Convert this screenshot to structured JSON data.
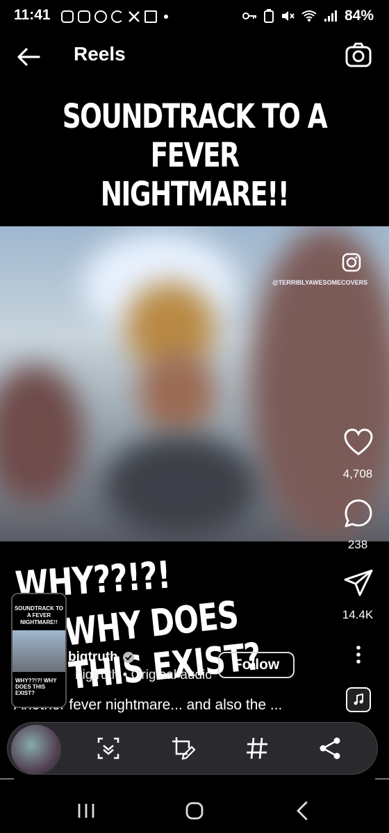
{
  "status_bar": {
    "time": "11:41",
    "battery": "84%",
    "left_icons": [
      "discord-icon",
      "instagram-icon",
      "check-circle-icon",
      "crunchyroll-icon",
      "x-icon",
      "twitch-icon"
    ],
    "right_icons": [
      "key-icon",
      "battery-saver-icon",
      "mute-icon",
      "wifi-icon",
      "signal-icon"
    ]
  },
  "header": {
    "title": "Reels",
    "back_icon": "arrow-left-icon",
    "camera_icon": "camera-icon"
  },
  "reel": {
    "headline": "SOUNDTRACK TO A FEVER NIGHTMARE!!",
    "watermark": "@TERRIBLYAWESOMECOVERS",
    "caption_top": "WHY??!?!",
    "caption_bottom": "WHY DOES THIS EXIST?",
    "author": "bigtruth",
    "audio": "bigtruth • Original audio",
    "follow_label": "Follow",
    "description": "Another fever nightmare... and also the ..."
  },
  "actions": {
    "likes": "4,708",
    "comments": "238",
    "shares": "14.4K"
  },
  "mini_preview": {
    "title": "SOUNDTRACK TO A FEVER NIGHTMARE!!",
    "caption": "WHY??!?! WHY DOES THIS EXIST?"
  },
  "toolbar": {
    "icons": [
      "scroll-capture-icon",
      "crop-edit-icon",
      "hashtag-icon",
      "share-icon"
    ]
  },
  "colors": {
    "background": "#000000",
    "toolbar": "#2a2a2e",
    "text": "#ffffff"
  }
}
